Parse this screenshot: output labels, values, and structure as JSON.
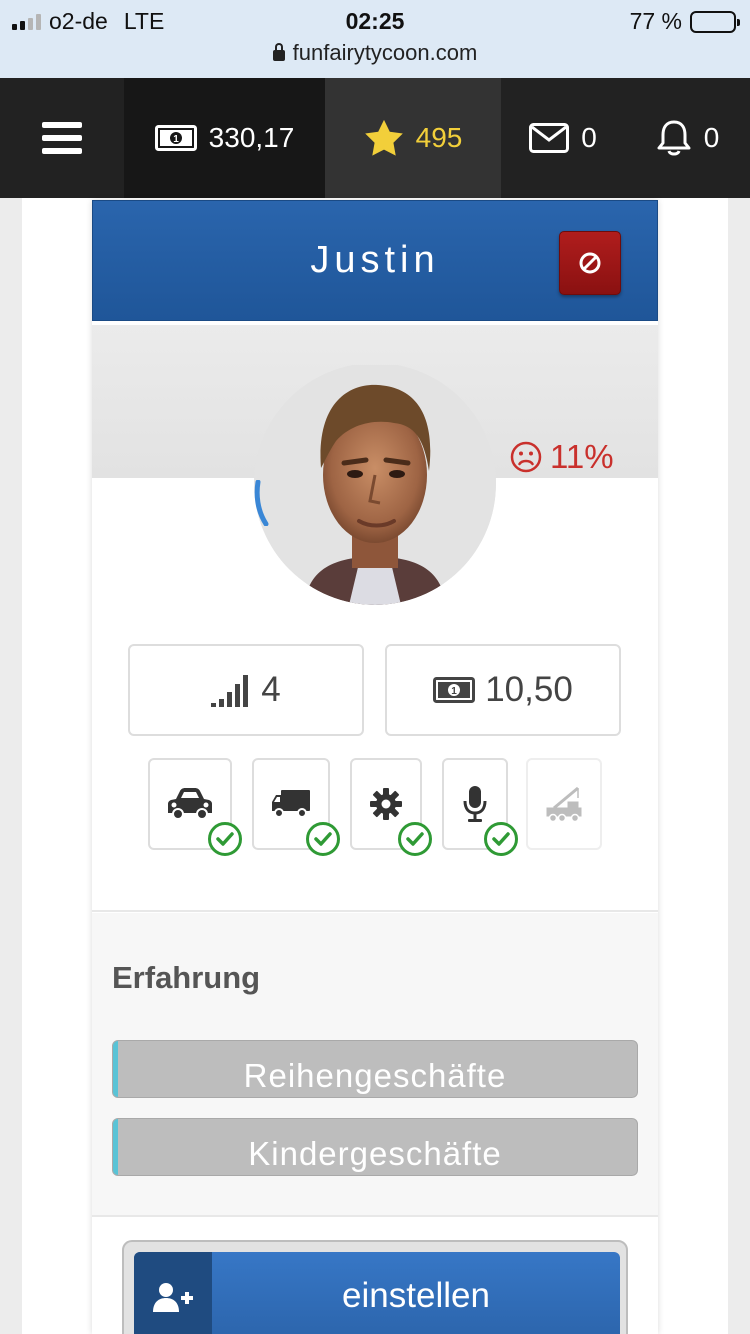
{
  "status_bar": {
    "carrier": "o2-de",
    "network": "LTE",
    "time": "02:25",
    "battery": "77 %",
    "battery_level": 0.77,
    "url": "funfairytycoon.com"
  },
  "nav": {
    "money": "330,17",
    "stars": "495",
    "messages": "0",
    "notifications": "0",
    "icons": [
      "menu-icon",
      "banknote-icon",
      "star-icon",
      "envelope-icon",
      "bell-icon"
    ]
  },
  "employee": {
    "name": "Justin",
    "mood": "11%",
    "mood_icon": "frown-icon",
    "skill_level": "4",
    "wage": "10,50"
  },
  "licenses": [
    {
      "icon": "car-icon",
      "has": true
    },
    {
      "icon": "truck-icon",
      "has": true
    },
    {
      "icon": "gear-icon",
      "has": true
    },
    {
      "icon": "microphone-icon",
      "has": true
    },
    {
      "icon": "crane-truck-icon",
      "has": false
    }
  ],
  "experience": {
    "title": "Erfahrung",
    "items": [
      {
        "label": "Reihengeschäfte",
        "progress": 0.01
      },
      {
        "label": "Kindergeschäfte",
        "progress": 0.01
      }
    ]
  },
  "hire": {
    "label": "einstellen",
    "icon": "user-plus-icon"
  },
  "colors": {
    "header_blue": "#2a65ad",
    "fire_red": "#a01818",
    "mood_red": "#c9302c",
    "check_green": "#2f9a35",
    "star_yellow": "#f2cf3a",
    "exp_fill": "#59c3d6"
  }
}
